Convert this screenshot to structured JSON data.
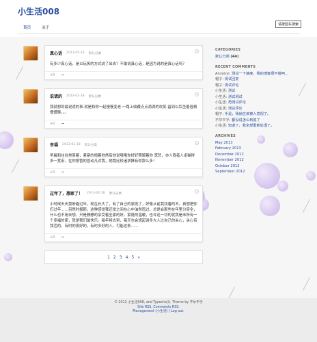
{
  "site": {
    "title": "小生活008"
  },
  "nav": {
    "items": [
      {
        "label": "首页"
      },
      {
        "label": "关于"
      }
    ]
  },
  "search": {
    "label": "请按回车搜索"
  },
  "posts": [
    {
      "title": "真心话",
      "date": "2013-05-23",
      "category": "默认分类",
      "body": "有多少真心话，是以玩笑的方式说了出去？不敢说真心话，是因为说的是真心话吗？",
      "foot": "+0"
    },
    {
      "title": "说谎的",
      "date": "2013-02-18",
      "category": "默认分类",
      "body": "我就想到最说谎的事.就是和你一起慢慢变老.一路上收藏点点滴滴的欢笑.留到以后坐着摇椅慢慢聊。。。",
      "foot": "+0"
    },
    {
      "title": "幸福",
      "date": "2013-02-18",
      "category": "默认分类",
      "body": "早晨和往往常笑着，紧紧的抱着他然后他说哦哦你好好照顾着你 宽恕，亦人我者人卓猫得多一宽宏，在你想暂的冒动凡对我，她我比较追求推有你那么多！",
      "foot": "+0"
    },
    {
      "title": "过年了，想家了！",
      "date": "2013-02-18",
      "category": "默认分类",
      "body": "小时候天天我盼着过年，现在长大了，有了自己的家庭了，好像从前我找着的不。真想把你们过年……另然时报那，这种感觉我还觉之间在心中油然而过，总是会那些在年里分穿全，什么也不用去想，只是静静的享受着全家的好。家庭的温暖，也许这一切的就我是未所有一个幸福的家，就是我们最快乐。每年将去到，每天也会想起讲多大人过自己的关心，关心有我活的，有时的夜好的，有时多好的人。可能这条……",
      "foot": "+0"
    }
  ],
  "pager": {
    "pages": [
      "1",
      "2",
      "3",
      "4",
      "5",
      "»"
    ]
  },
  "sidebar": {
    "categories_h": "CATEGORIES",
    "category": {
      "name": "默认分类",
      "count": "(44)"
    },
    "comments_h": "RECENT COMMENTS",
    "comments": [
      {
        "author": "Anxonyi",
        "text": "测试一下速度，我的博客很不错呵..."
      },
      {
        "author": "帽子",
        "text": "测试回复"
      },
      {
        "author": "帽子",
        "text": "测试评论"
      },
      {
        "author": "小生活",
        "text": "测试"
      },
      {
        "author": "小生活",
        "text": "测试测试"
      },
      {
        "author": "小生活",
        "text": "再测试评论"
      },
      {
        "author": "小生活",
        "text": "测试评论"
      },
      {
        "author": "帽子",
        "text": "手是，我就应该被人忽视了。"
      },
      {
        "author": "不尔平乎",
        "text": "都没说怎么到底了"
      },
      {
        "author": "小生活",
        "text": "知道了，我全部重新处理了。"
      }
    ],
    "archives_h": "ARCHIVES",
    "archives": [
      "May 2013",
      "February 2013",
      "December 2012",
      "November 2012",
      "October 2012",
      "September 2012"
    ]
  },
  "footer": {
    "line1": "© 2012 小生活008, and Typecho(i). Theme by 不尔平乎",
    "line2": "Site RSS, Comments RSS.",
    "line3": "Management (小生活) | Log out."
  }
}
